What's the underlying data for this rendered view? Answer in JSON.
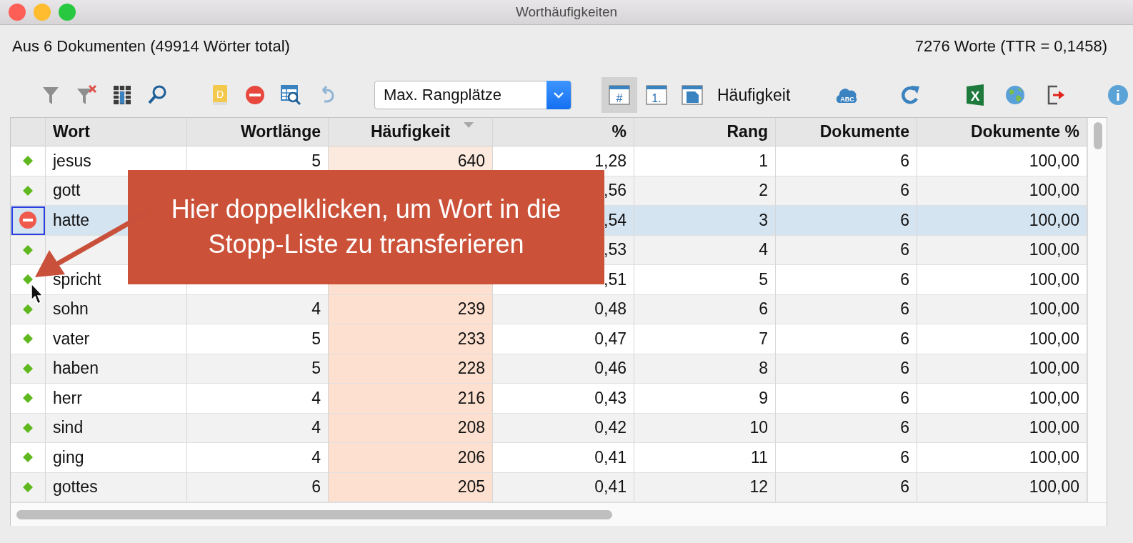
{
  "window": {
    "title": "Worthäufigkeiten"
  },
  "summary_left": "Aus 6 Dokumenten (49914 Wörter total)",
  "summary_right": "7276 Worte (TTR = 0,1458)",
  "toolbar": {
    "groups": [
      [
        {
          "kind": "filter"
        },
        {
          "kind": "filter-clear"
        },
        {
          "kind": "columns"
        },
        {
          "kind": "search"
        }
      ],
      [
        {
          "kind": "book",
          "glyph": "D"
        },
        {
          "kind": "stop"
        },
        {
          "kind": "table-search"
        },
        {
          "kind": "undo"
        }
      ],
      [
        {
          "kind": "dropdown",
          "value": "Max. Rangplätze"
        }
      ],
      [
        {
          "kind": "view-hash",
          "glyph": "#",
          "selected": true
        },
        {
          "kind": "view-rank",
          "glyph": "1.",
          "selected": false
        },
        {
          "kind": "view-page",
          "selected": false
        },
        {
          "kind": "label",
          "text": "Häufigkeit"
        }
      ],
      [
        {
          "kind": "cloud",
          "glyph": "ABC"
        },
        {
          "kind": "refresh"
        }
      ],
      [
        {
          "kind": "excel",
          "glyph": "X"
        },
        {
          "kind": "globe"
        },
        {
          "kind": "export"
        }
      ],
      [
        {
          "kind": "info",
          "glyph": "i"
        }
      ]
    ]
  },
  "table": {
    "columns": [
      {
        "label": "Wort",
        "sorted": false
      },
      {
        "label": "Wortlänge",
        "sorted": false
      },
      {
        "label": "Häufigkeit",
        "sorted": true
      },
      {
        "label": "%",
        "sorted": false
      },
      {
        "label": "Rang",
        "sorted": false
      },
      {
        "label": "Dokumente",
        "sorted": false
      },
      {
        "label": "Dokumente %",
        "sorted": false
      }
    ],
    "rows": [
      {
        "stop_listed": false,
        "selected": false,
        "cells": [
          "jesus",
          "5",
          "640",
          "1,28",
          "1",
          "6",
          "100,00"
        ]
      },
      {
        "stop_listed": false,
        "selected": false,
        "cells": [
          "gott",
          null,
          null,
          ",56",
          "2",
          "6",
          "100,00"
        ]
      },
      {
        "stop_listed": true,
        "selected": true,
        "cells": [
          "hatte",
          null,
          null,
          ",54",
          "3",
          "6",
          "100,00"
        ]
      },
      {
        "stop_listed": false,
        "selected": false,
        "cells": [
          null,
          null,
          null,
          ",53",
          "4",
          "6",
          "100,00"
        ]
      },
      {
        "stop_listed": false,
        "selected": false,
        "cells": [
          "spricht",
          null,
          null,
          ",51",
          "5",
          "6",
          "100,00"
        ]
      },
      {
        "stop_listed": false,
        "selected": false,
        "cells": [
          "sohn",
          "4",
          "239",
          "0,48",
          "6",
          "6",
          "100,00"
        ]
      },
      {
        "stop_listed": false,
        "selected": false,
        "cells": [
          "vater",
          "5",
          "233",
          "0,47",
          "7",
          "6",
          "100,00"
        ]
      },
      {
        "stop_listed": false,
        "selected": false,
        "cells": [
          "haben",
          "5",
          "228",
          "0,46",
          "8",
          "6",
          "100,00"
        ]
      },
      {
        "stop_listed": false,
        "selected": false,
        "cells": [
          "herr",
          "4",
          "216",
          "0,43",
          "9",
          "6",
          "100,00"
        ]
      },
      {
        "stop_listed": false,
        "selected": false,
        "cells": [
          "sind",
          "4",
          "208",
          "0,42",
          "10",
          "6",
          "100,00"
        ]
      },
      {
        "stop_listed": false,
        "selected": false,
        "cells": [
          "ging",
          "4",
          "206",
          "0,41",
          "11",
          "6",
          "100,00"
        ]
      },
      {
        "stop_listed": false,
        "selected": false,
        "cells": [
          "gottes",
          "6",
          "205",
          "0,41",
          "12",
          "6",
          "100,00"
        ]
      }
    ]
  },
  "callout": {
    "text": "Hier doppelklicken, um Wort in die Stopp-Liste zu transferieren"
  }
}
